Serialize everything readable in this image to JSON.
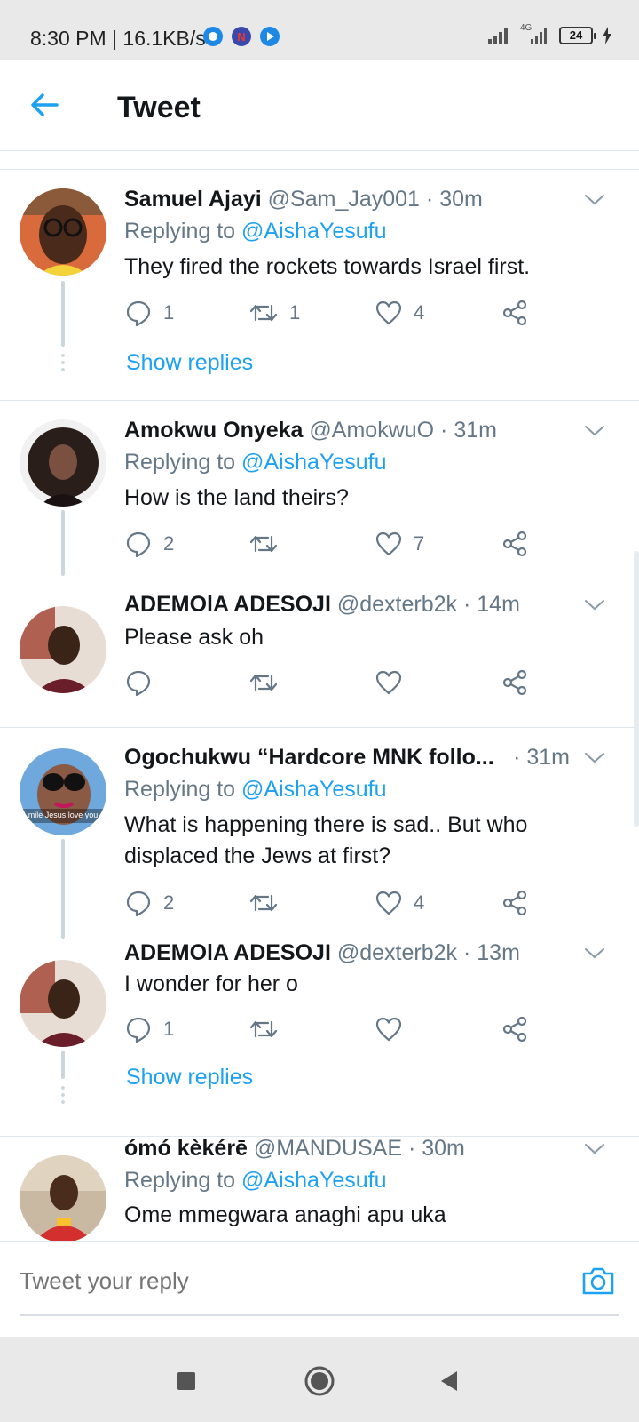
{
  "status_bar": {
    "time": "8:30 PM | 16.1KB/s",
    "network": "4G",
    "battery": "24"
  },
  "header": {
    "title": "Tweet"
  },
  "tweets": [
    {
      "name": "Samuel Ajayi",
      "handle": "@Sam_Jay001",
      "time": "· 30m",
      "replying_prefix": "Replying to",
      "replying_to": "@AishaYesufu",
      "text": "They fired the rockets towards Israel first.",
      "replies": "1",
      "retweets": "1",
      "likes": "4",
      "show_replies": "Show replies"
    },
    {
      "name": "Amokwu Onyeka",
      "handle": "@AmokwuO",
      "time": "· 31m",
      "replying_prefix": "Replying to",
      "replying_to": "@AishaYesufu",
      "text": "How is the land theirs?",
      "replies": "2",
      "retweets": "",
      "likes": "7"
    },
    {
      "name": "ADEMOlA ADESOJI",
      "handle": "@dexterb2k",
      "time": "· 14m",
      "text": "Please ask oh",
      "replies": "",
      "retweets": "",
      "likes": ""
    },
    {
      "name": "Ogochukwu “Hardcore MNK follo...",
      "handle": "",
      "time": "· 31m",
      "replying_prefix": "Replying to",
      "replying_to": "@AishaYesufu",
      "text": "What is happening there is sad.. But who displaced the Jews at first?",
      "replies": "2",
      "retweets": "",
      "likes": "4",
      "avatar_caption": "mile Jesus love you"
    },
    {
      "name": "ADEMOlA ADESOJI",
      "handle": "@dexterb2k",
      "time": "· 13m",
      "text": "I wonder for her o",
      "replies": "1",
      "retweets": "",
      "likes": "",
      "show_replies": "Show replies"
    },
    {
      "name": "ómó kèkérē",
      "handle": "@MANDUSAE",
      "time": "· 30m",
      "replying_prefix": "Replying to",
      "replying_to": "@AishaYesufu",
      "text": "Ome mmegwara anaghi apu uka"
    }
  ],
  "compose": {
    "placeholder": "Tweet your reply"
  },
  "colors": {
    "accent": "#1da1f2",
    "secondary_text": "#657786",
    "divider": "#e1e8ed"
  }
}
